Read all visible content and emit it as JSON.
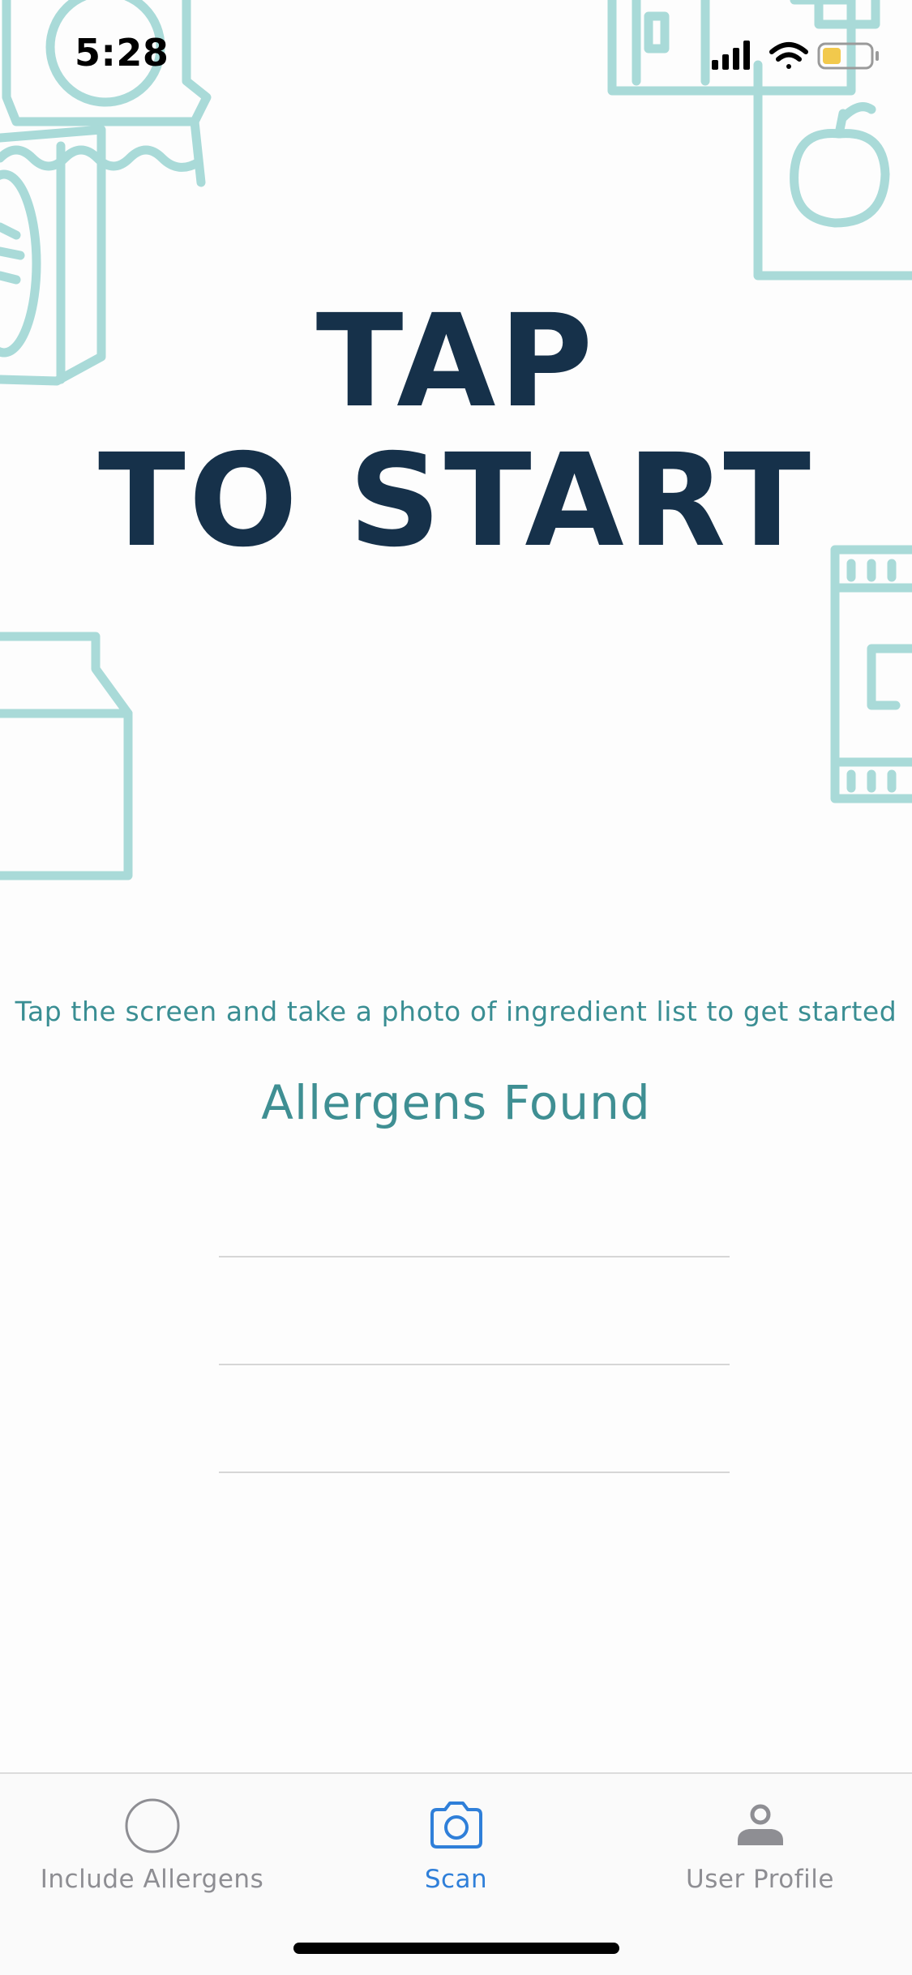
{
  "status_bar": {
    "time": "5:28"
  },
  "headline": {
    "line1": "TAP",
    "line2": "TO START"
  },
  "instruction": "Tap the screen and take a photo of ingredient list to get started",
  "allergens": {
    "title": "Allergens Found",
    "items": [
      "",
      "",
      ""
    ]
  },
  "tab_bar": {
    "tabs": [
      {
        "label": "Include Allergens",
        "icon": "circle-icon",
        "active": false
      },
      {
        "label": "Scan",
        "icon": "camera-icon",
        "active": true
      },
      {
        "label": "User Profile",
        "icon": "person-icon",
        "active": false
      }
    ]
  },
  "colors": {
    "headline": "#16314a",
    "accent_teal": "#3a8e93",
    "illustration": "#a9dad8",
    "tab_active": "#2f7fd9",
    "tab_inactive": "#8e8e93"
  }
}
